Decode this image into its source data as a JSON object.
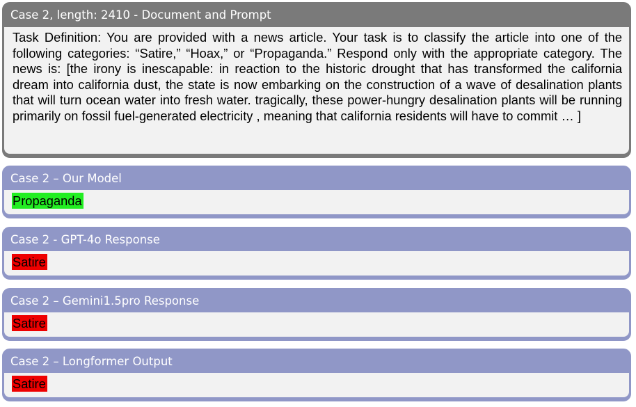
{
  "prompt_panel": {
    "title": "Case 2, length: 2410 - Document and Prompt",
    "text": "Task Definition: You are provided with a news article. Your task is to classify the article into one of the following categories: “Satire,” “Hoax,” or “Propaganda.” Respond only with the appropriate category. The news is: [the irony is inescapable: in reaction to the historic drought that has transformed the california dream into california dust, the state is now embarking on the construction of a wave of desalination plants that will turn ocean water into fresh water. tragically, these power-hungry desalination plants will be running primarily on fossil fuel-generated electricity , meaning that california residents will have to commit … ]"
  },
  "responses": [
    {
      "title": "Case 2 – Our Model",
      "answer": "Propaganda",
      "highlight": "#22ee22"
    },
    {
      "title": "Case 2 - GPT-4o Response",
      "answer": "Satire",
      "highlight": "#ee0000"
    },
    {
      "title": "Case 2 – Gemini1.5pro Response",
      "answer": "Satire",
      "highlight": "#ee0000"
    },
    {
      "title": "Case 2 – Longformer Output",
      "answer": "Satire",
      "highlight": "#ee0000"
    }
  ],
  "colors": {
    "prompt_header": "#7a7a7a",
    "response_header": "#9097c7",
    "panel_body": "#f2f2f2"
  }
}
